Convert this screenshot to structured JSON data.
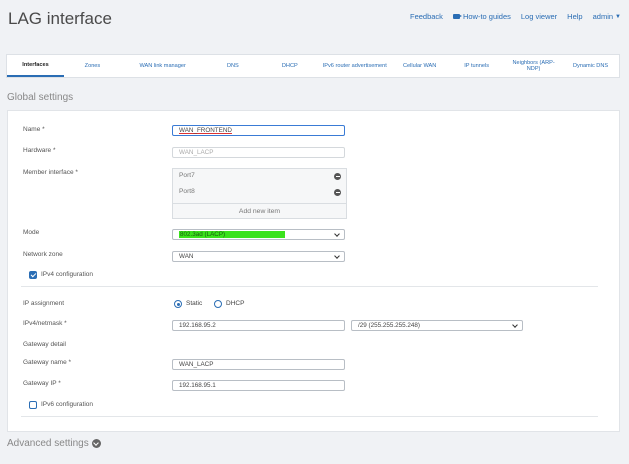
{
  "header": {
    "title": "LAG interface",
    "links": {
      "feedback": "Feedback",
      "how_to": "How-to guides",
      "log_viewer": "Log viewer",
      "help": "Help",
      "admin": "admin"
    }
  },
  "tabs": [
    {
      "label": "Interfaces",
      "active": true
    },
    {
      "label": "Zones"
    },
    {
      "label": "WAN link manager"
    },
    {
      "label": "DNS"
    },
    {
      "label": "DHCP"
    },
    {
      "label": "IPv6 router advertisement"
    },
    {
      "label": "Cellular WAN"
    },
    {
      "label": "IP tunnels"
    },
    {
      "label": "Neighbors (ARP-NDP)"
    },
    {
      "label": "Dynamic DNS"
    }
  ],
  "global_settings": {
    "title": "Global settings",
    "name_label": "Name *",
    "name_value": "WAN_FRONTEND",
    "hardware_label": "Hardware *",
    "hardware_value": "WAN_LACP",
    "member_label": "Member interface *",
    "members": [
      "Port7",
      "Port8"
    ],
    "add_new_item": "Add new item",
    "mode_label": "Mode",
    "mode_value": "802.3ad (LACP)",
    "zone_label": "Network zone",
    "zone_value": "WAN",
    "ipv4_config_label": "IPv4 configuration",
    "ip_assignment_label": "IP assignment",
    "static_label": "Static",
    "dhcp_label": "DHCP",
    "ipv4_netmask_label": "IPv4/netmask *",
    "ipv4_value": "192.168.95.2",
    "netmask_value": "/29 (255.255.255.248)",
    "gateway_detail_label": "Gateway detail",
    "gateway_name_label": "Gateway name *",
    "gateway_name_value": "WAN_LACP",
    "gateway_ip_label": "Gateway IP *",
    "gateway_ip_value": "192.168.95.1",
    "ipv6_config_label": "IPv6 configuration"
  },
  "advanced_settings": {
    "title": "Advanced settings"
  },
  "colors": {
    "accent": "#2a6db4",
    "highlight": "#3ae21c"
  }
}
